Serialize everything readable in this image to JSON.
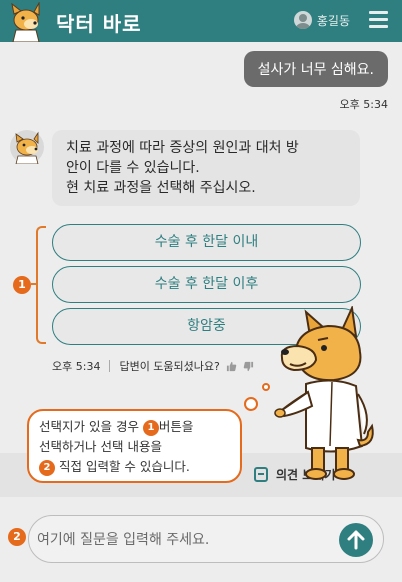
{
  "header": {
    "title": "닥터 바로",
    "user_name": "홍길동"
  },
  "chat": {
    "user_message": "설사가 너무 심해요.",
    "user_time": "오후 5:34",
    "bot_lines": [
      "치료 과정에 따라 증상의 원인과 대처 방",
      "안이 다를 수 있습니다.",
      "현 치료 과정을 선택해 주십시오."
    ],
    "options": [
      "수술 후 한달 이내",
      "수술 후 한달 이후",
      "항암중"
    ],
    "bot_time": "오후 5:34",
    "feedback_question": "답변이 도움되셨나요?"
  },
  "guide": {
    "badge_1": "1",
    "badge_2": "2",
    "line_1_pre": "선택지가 있을 경우 ",
    "line_1_post": "버튼을",
    "line_2": "선택하거나 선택 내용을",
    "line_3": "직접 입력할 수 있습니다."
  },
  "opinion": {
    "label": "의견 보내기"
  },
  "input": {
    "placeholder": "여기에 질문을 입력해 주세요."
  },
  "colors": {
    "brand": "#2f7f81",
    "accent": "#e56a1c"
  },
  "icons": [
    "dog-logo-icon",
    "user-icon",
    "menu-icon",
    "dog-avatar-icon",
    "thumbs-up-icon",
    "thumbs-down-icon",
    "document-icon",
    "send-arrow-icon"
  ]
}
